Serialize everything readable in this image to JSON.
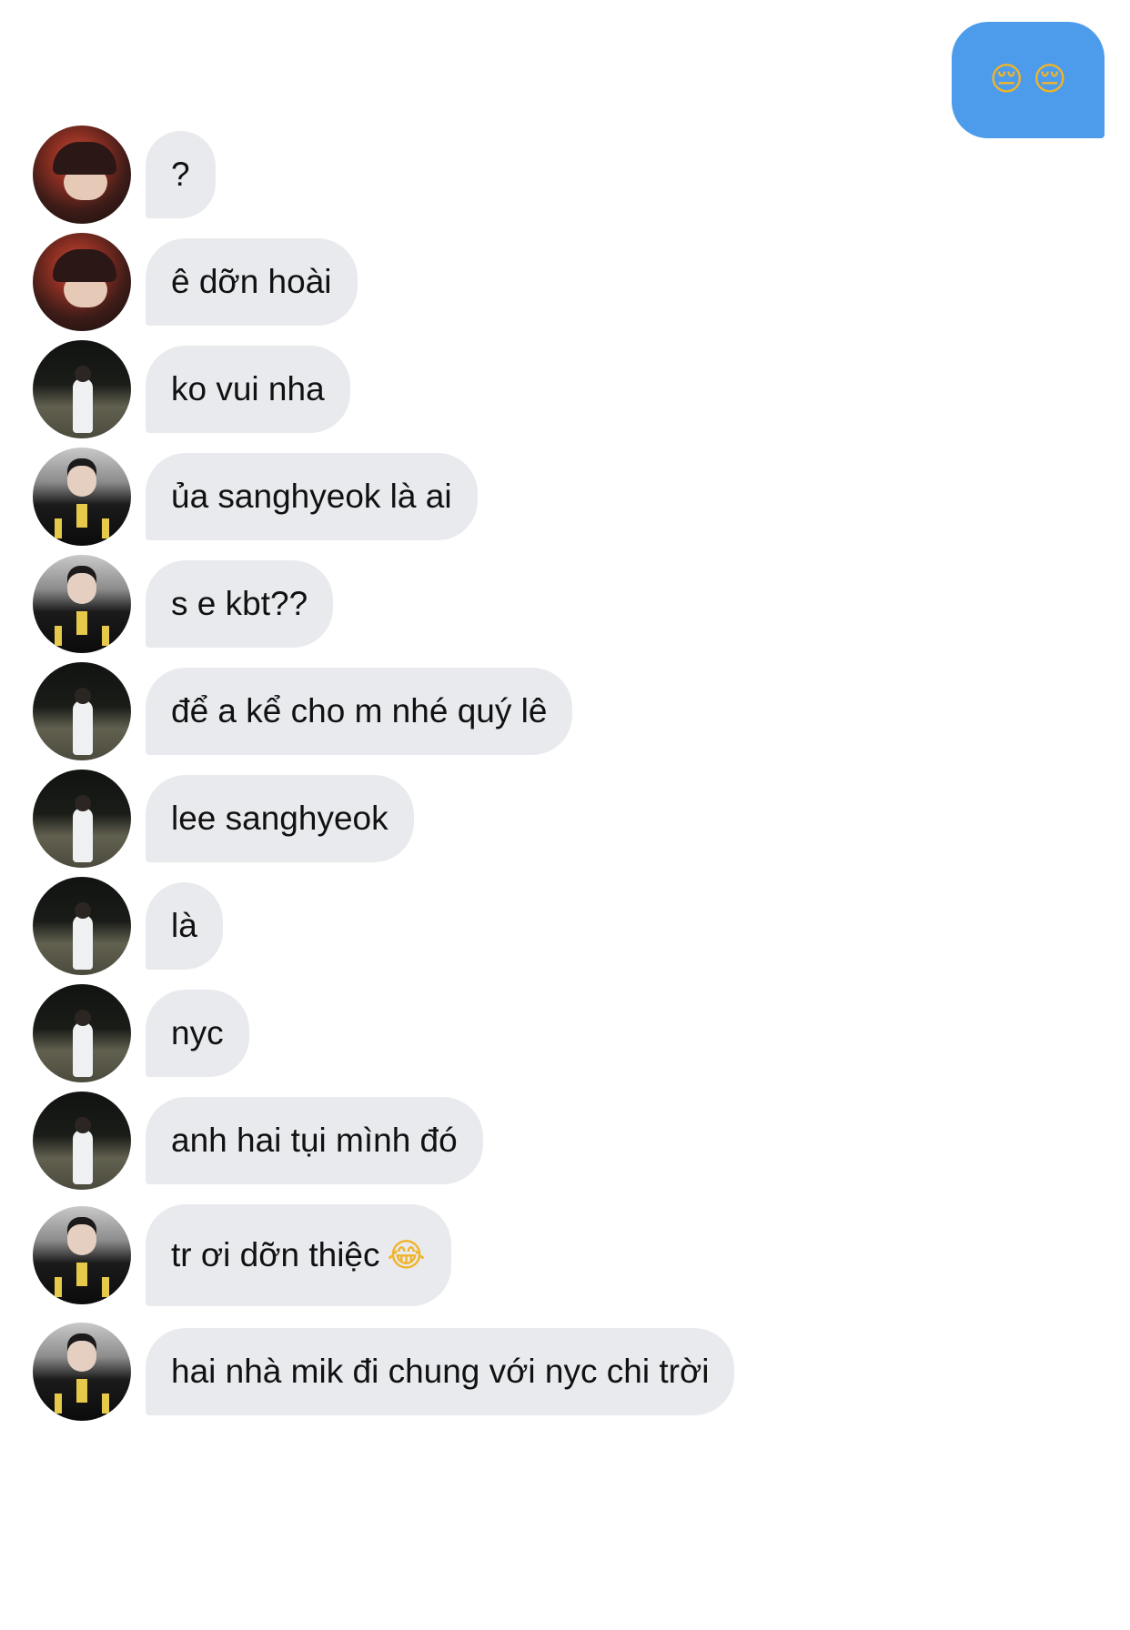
{
  "colors": {
    "sent_bubble": "#4d9cec",
    "received_bubble": "#e9eaee",
    "text": "#111111",
    "background": "#ffffff"
  },
  "sent_message": {
    "emoji": [
      "😔",
      "😔"
    ]
  },
  "messages": [
    {
      "sender_avatar": "avatar-mask-person",
      "text": "?"
    },
    {
      "sender_avatar": "avatar-mask-person",
      "text": "ê dỡn hoài"
    },
    {
      "sender_avatar": "avatar-field-person",
      "text": "ko vui nha"
    },
    {
      "sender_avatar": "avatar-jersey-person",
      "text": "ủa sanghyeok là ai"
    },
    {
      "sender_avatar": "avatar-jersey-person",
      "text": "s e kbt??"
    },
    {
      "sender_avatar": "avatar-field-person",
      "text": "để a kể cho m nhé quý lê"
    },
    {
      "sender_avatar": "avatar-field-person",
      "text": "lee sanghyeok"
    },
    {
      "sender_avatar": "avatar-field-person",
      "text": "là"
    },
    {
      "sender_avatar": "avatar-field-person",
      "text": "nyc"
    },
    {
      "sender_avatar": "avatar-field-person",
      "text": "anh hai tụi mình đó"
    },
    {
      "sender_avatar": "avatar-jersey-person",
      "text": "tr ơi dỡn thiệc",
      "emoji": "😂"
    },
    {
      "sender_avatar": "avatar-jersey-person",
      "text": "hai nhà mik đi chung với nyc chi trời"
    }
  ]
}
